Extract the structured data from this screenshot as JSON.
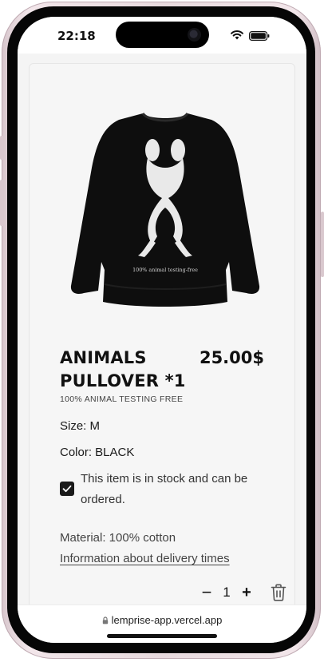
{
  "status_bar": {
    "time": "22:18"
  },
  "product": {
    "title": "ANIMALS PULLOVER *1",
    "price": "25.00$",
    "subtitle": "100% ANIMAL TESTING FREE",
    "image_print_text": "100% animal testing-free",
    "size": "Size: M",
    "color": "Color: BLACK",
    "stock_checked": true,
    "stock_text": "This item is in stock and can be ordered.",
    "material": "Material: 100% cotton",
    "delivery_link": "Information about delivery times",
    "quantity": "1",
    "minus_label": "−",
    "plus_label": "+"
  },
  "browser": {
    "url": "lemprise-app.vercel.app"
  },
  "icons": {
    "wifi": "wifi-icon",
    "battery": "battery-icon",
    "checkbox": "check-icon",
    "delete": "trash-icon",
    "lock": "lock-icon"
  },
  "colors": {
    "frame": "#e8dade",
    "garment": "#0e0e0e",
    "text": "#111111",
    "checkbox": "#1a1a1a"
  }
}
